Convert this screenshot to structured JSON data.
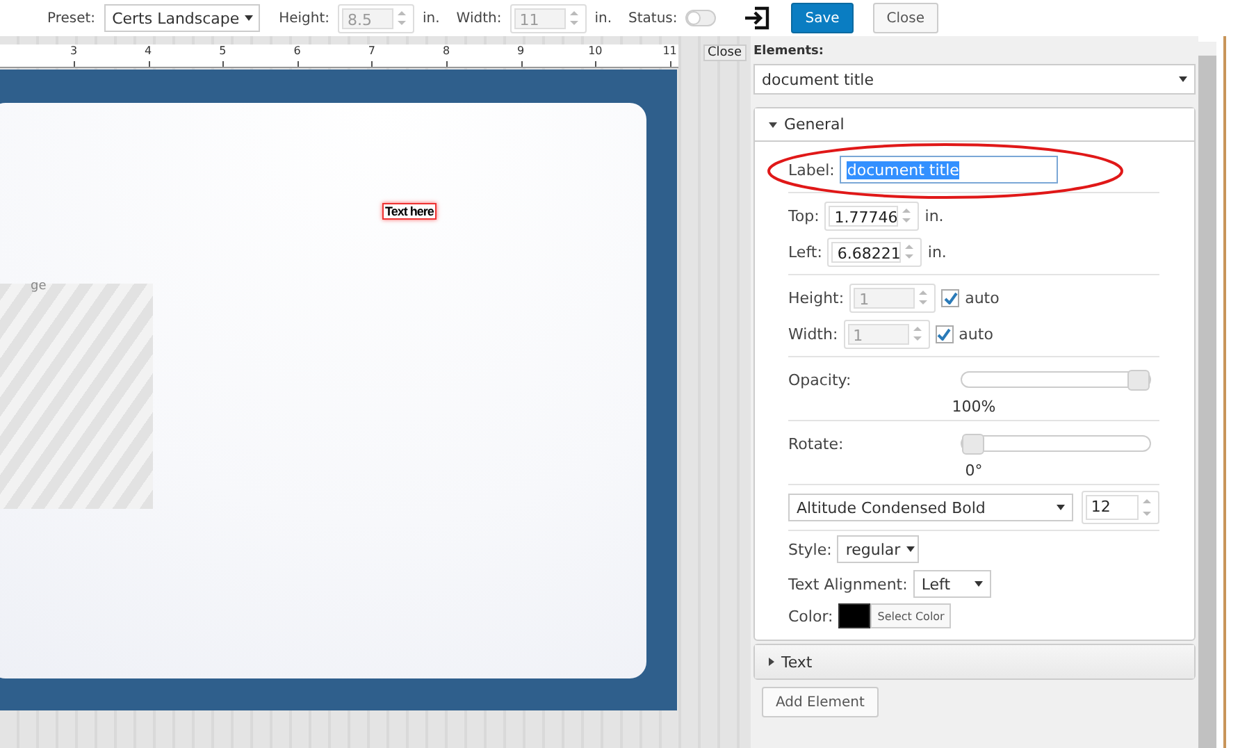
{
  "toolbar": {
    "preset": {
      "label": "Preset:",
      "value": "Certs Landscape"
    },
    "height": {
      "label": "Height:",
      "value": "8.5",
      "unit": "in.",
      "disabled": true
    },
    "width": {
      "label": "Width:",
      "value": "11",
      "unit": "in.",
      "disabled": true
    },
    "status": {
      "label": "Status:",
      "on": false
    },
    "buttons": [
      {
        "label": "Save",
        "kind": "primary"
      },
      {
        "label": "Close",
        "kind": "default"
      }
    ]
  },
  "canvas": {
    "ruler_ticks": [
      "3",
      "4",
      "5",
      "6",
      "7",
      "8",
      "9",
      "10",
      "11"
    ],
    "tooltip": "Close",
    "text_element": {
      "text": "Text here",
      "selected": true
    },
    "image_caption": "ge"
  },
  "panel": {
    "elements_label": "Elements:",
    "element": "document title",
    "general": {
      "title": "General",
      "expanded": true,
      "label": {
        "label": "Label:",
        "value": "document title",
        "text_selected": true,
        "circled": true
      },
      "top": {
        "label": "Top:",
        "value": "1.77746",
        "unit": "in."
      },
      "left": {
        "label": "Left:",
        "value": "6.68221",
        "unit": "in."
      },
      "height": {
        "label": "Height:",
        "value": "1",
        "disabled": true,
        "auto_label": "auto",
        "auto": true
      },
      "width": {
        "label": "Width:",
        "value": "1",
        "disabled": true,
        "auto_label": "auto",
        "auto": true
      },
      "opacity": {
        "label": "Opacity:",
        "level": 1,
        "reading": "100%"
      },
      "rotate": {
        "label": "Rotate:",
        "level": 0,
        "reading": "0°"
      },
      "font": {
        "value": "Altitude Condensed Bold",
        "size": "12"
      },
      "style": {
        "label": "Style:",
        "value": "regular"
      },
      "alignment": {
        "label": "Text Alignment:",
        "value": "Left"
      },
      "color": {
        "label": "Color:",
        "color": "#000000",
        "button": "Select Color"
      }
    },
    "text_section": {
      "title": "Text",
      "expanded": false
    },
    "add_button": "Add Element"
  }
}
